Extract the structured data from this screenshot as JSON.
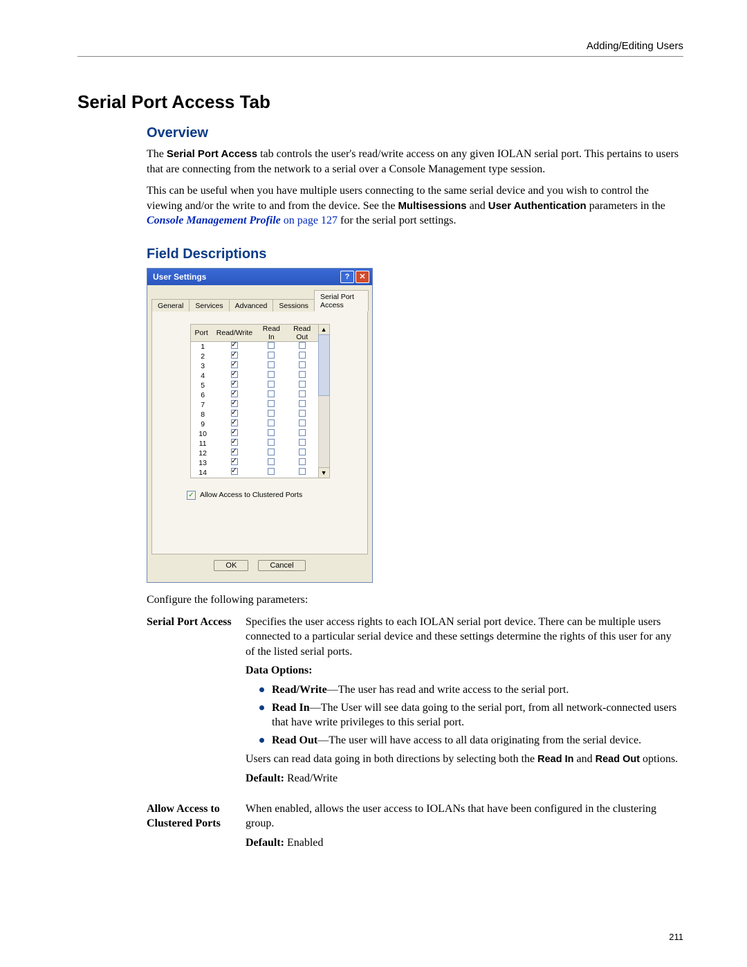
{
  "breadcrumb": "Adding/Editing Users",
  "section_title": "Serial Port Access Tab",
  "overview": {
    "heading": "Overview",
    "para1_pre": "The ",
    "para1_bold1": "Serial Port Access",
    "para1_post": " tab controls the user's read/write access on any given IOLAN serial port. This pertains to users that are connecting from the network to a serial over a Console Management type session.",
    "para2_pre": "This can be useful when you have multiple users connecting to the same serial device and you wish to control the viewing and/or the write to and from the device. See the ",
    "para2_bold_multi": "Multisessions",
    "para2_and": " and ",
    "para2_bold_userauth": "User Authentication",
    "para2_mid": " parameters in the ",
    "para2_link_text": "Console Management Profile",
    "para2_link_tail": " on page 127",
    "para2_post": " for the serial port settings."
  },
  "field_desc": {
    "heading": "Field Descriptions",
    "configure_line": "Configure the following parameters:"
  },
  "dialog": {
    "title": "User Settings",
    "tabs": [
      "General",
      "Services",
      "Advanced",
      "Sessions",
      "Serial Port Access"
    ],
    "active_tab_index": 4,
    "headers": [
      "Port",
      "Read/Write",
      "Read In",
      "Read Out"
    ],
    "rows": [
      {
        "port": "1",
        "rw": true,
        "rin": false,
        "rout": false
      },
      {
        "port": "2",
        "rw": true,
        "rin": false,
        "rout": false
      },
      {
        "port": "3",
        "rw": true,
        "rin": false,
        "rout": false
      },
      {
        "port": "4",
        "rw": true,
        "rin": false,
        "rout": false
      },
      {
        "port": "5",
        "rw": true,
        "rin": false,
        "rout": false
      },
      {
        "port": "6",
        "rw": true,
        "rin": false,
        "rout": false
      },
      {
        "port": "7",
        "rw": true,
        "rin": false,
        "rout": false
      },
      {
        "port": "8",
        "rw": true,
        "rin": false,
        "rout": false
      },
      {
        "port": "9",
        "rw": true,
        "rin": false,
        "rout": false
      },
      {
        "port": "10",
        "rw": true,
        "rin": false,
        "rout": false
      },
      {
        "port": "11",
        "rw": true,
        "rin": false,
        "rout": false
      },
      {
        "port": "12",
        "rw": true,
        "rin": false,
        "rout": false
      },
      {
        "port": "13",
        "rw": true,
        "rin": false,
        "rout": false
      },
      {
        "port": "14",
        "rw": true,
        "rin": false,
        "rout": false
      }
    ],
    "cluster_checkbox_label": "Allow Access to Clustered Ports",
    "cluster_checkbox_checked": true,
    "ok": "OK",
    "cancel": "Cancel"
  },
  "descriptions": [
    {
      "term": "Serial Port Access",
      "body_intro": "Specifies the user access rights to each IOLAN serial port device. There can be multiple users connected to a particular serial device and these settings determine the rights of this user for any of the listed serial ports.",
      "data_options_label": "Data Options:",
      "options": [
        {
          "bold": "Read/Write",
          "text": "—The user has read and write access to the serial port."
        },
        {
          "bold": "Read In",
          "text": "—The User will see data going to the serial port, from all network-connected users that have write privileges to this serial port."
        },
        {
          "bold": "Read Out",
          "text": "—The user will have access to all data originating from the serial device."
        }
      ],
      "both_pre": "Users can read data going in both directions by selecting both the ",
      "both_b1": "Read In",
      "both_mid": " and ",
      "both_b2": "Read Out",
      "both_post": " options.",
      "default_label": "Default:",
      "default_value": " Read/Write"
    },
    {
      "term": "Allow Access to Clustered Ports",
      "body_intro": "When enabled, allows the user access to IOLANs that have been configured in the clustering group.",
      "default_label": "Default:",
      "default_value": " Enabled"
    }
  ],
  "page_number": "211"
}
